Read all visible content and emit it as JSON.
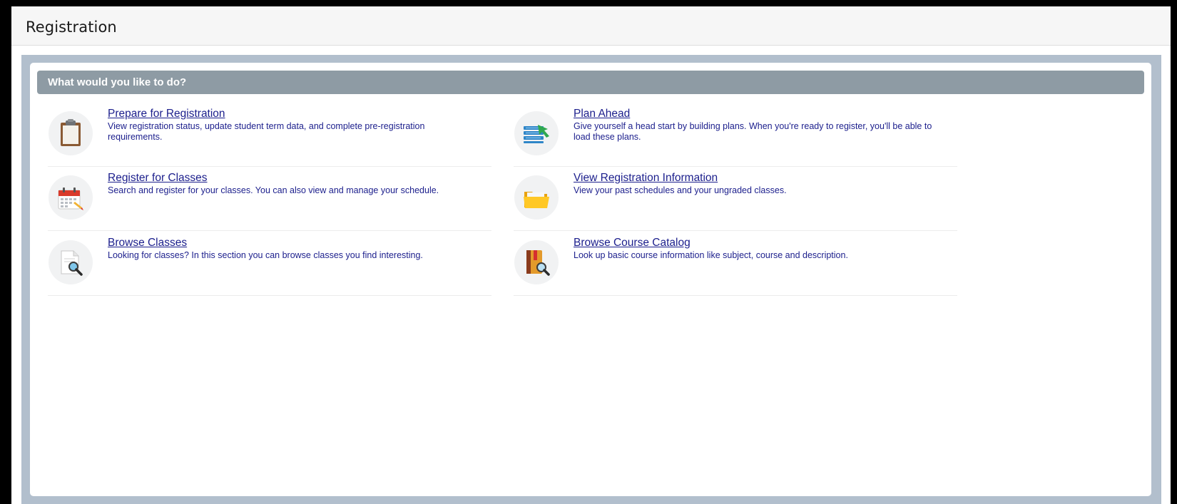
{
  "page": {
    "title": "Registration"
  },
  "section": {
    "heading": "What would you like to do?"
  },
  "items": [
    {
      "title": "Prepare for Registration",
      "description": "View registration status, update student term data, and complete pre-registration requirements.",
      "icon": "clipboard-icon"
    },
    {
      "title": "Plan Ahead",
      "description": "Give yourself a head start by building plans. When you're ready to register, you'll be able to load these plans.",
      "icon": "plan-list-icon"
    },
    {
      "title": "Register for Classes",
      "description": "Search and register for your classes. You can also view and manage your schedule.",
      "icon": "calendar-pencil-icon"
    },
    {
      "title": "View Registration Information",
      "description": "View your past schedules and your ungraded classes.",
      "icon": "folder-icon"
    },
    {
      "title": "Browse Classes",
      "description": "Looking for classes? In this section you can browse classes you find interesting.",
      "icon": "document-search-icon"
    },
    {
      "title": "Browse Course Catalog",
      "description": "Look up basic course information like subject, course and description.",
      "icon": "book-search-icon"
    }
  ],
  "colors": {
    "link": "#1b1e8c",
    "section_bar": "#8e9ba4",
    "outer_panel": "#b2bfcd",
    "header_bg": "#f6f6f6"
  }
}
